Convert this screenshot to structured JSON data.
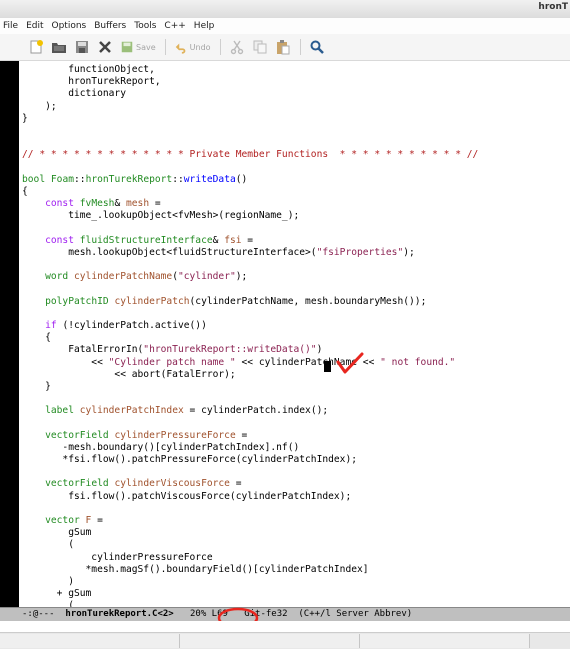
{
  "window": {
    "title": "hronT"
  },
  "menubar": {
    "items": [
      "File",
      "Edit",
      "Options",
      "Buffers",
      "Tools",
      "C++",
      "Help"
    ]
  },
  "toolbar": {
    "save_label": "Save",
    "undo_label": "Undo",
    "icons": [
      "new-file-icon",
      "open-folder-icon",
      "save-disk-icon",
      "close-x-icon",
      "save-icon",
      "undo-icon",
      "cut-icon",
      "copy-icon",
      "paste-icon",
      "search-icon"
    ]
  },
  "editor": {
    "lines": [
      [
        {
          "t": "        functionObject,"
        }
      ],
      [
        {
          "t": "        hronTurekReport,"
        }
      ],
      [
        {
          "t": "        dictionary"
        }
      ],
      [
        {
          "t": "    );"
        }
      ],
      [
        {
          "t": "}"
        }
      ],
      [
        {
          "t": ""
        }
      ],
      [
        {
          "t": ""
        }
      ],
      [
        {
          "t": "// * * * * * * * * * * * * * Private Member Functions  * * * * * * * * * * * //",
          "c": "cm"
        }
      ],
      [
        {
          "t": ""
        }
      ],
      [
        {
          "t": "bool",
          "c": "ty"
        },
        {
          "t": " "
        },
        {
          "t": "Foam",
          "c": "ty"
        },
        {
          "t": "::"
        },
        {
          "t": "hronTurekReport",
          "c": "ty"
        },
        {
          "t": "::"
        },
        {
          "t": "writeData",
          "c": "fn"
        },
        {
          "t": "()"
        }
      ],
      [
        {
          "t": "{"
        }
      ],
      [
        {
          "t": "    "
        },
        {
          "t": "const",
          "c": "kw"
        },
        {
          "t": " "
        },
        {
          "t": "fvMesh",
          "c": "ty"
        },
        {
          "t": "& "
        },
        {
          "t": "mesh",
          "c": "vr"
        },
        {
          "t": " ="
        }
      ],
      [
        {
          "t": "        time_.lookupObject<fvMesh>(regionName_);"
        }
      ],
      [
        {
          "t": ""
        }
      ],
      [
        {
          "t": "    "
        },
        {
          "t": "const",
          "c": "kw"
        },
        {
          "t": " "
        },
        {
          "t": "fluidStructureInterface",
          "c": "ty"
        },
        {
          "t": "& "
        },
        {
          "t": "fsi",
          "c": "vr"
        },
        {
          "t": " ="
        }
      ],
      [
        {
          "t": "        mesh.lookupObject<fluidStructureInterface>("
        },
        {
          "t": "\"fsiProperties\"",
          "c": "st"
        },
        {
          "t": ");"
        }
      ],
      [
        {
          "t": ""
        }
      ],
      [
        {
          "t": "    "
        },
        {
          "t": "word",
          "c": "ty"
        },
        {
          "t": " "
        },
        {
          "t": "cylinderPatchName",
          "c": "vr"
        },
        {
          "t": "("
        },
        {
          "t": "\"cylinder\"",
          "c": "st"
        },
        {
          "t": ");"
        }
      ],
      [
        {
          "t": ""
        }
      ],
      [
        {
          "t": "    "
        },
        {
          "t": "polyPatchID",
          "c": "ty"
        },
        {
          "t": " "
        },
        {
          "t": "cylinderPatch",
          "c": "vr"
        },
        {
          "t": "(cylinderPatchName, mesh.boundaryMesh());"
        }
      ],
      [
        {
          "t": ""
        }
      ],
      [
        {
          "t": "    "
        },
        {
          "t": "if",
          "c": "kw"
        },
        {
          "t": " (!cylinderPatch.active())"
        }
      ],
      [
        {
          "t": "    {"
        }
      ],
      [
        {
          "t": "        FatalErrorIn("
        },
        {
          "t": "\"hronTurekReport::writeData()\"",
          "c": "st"
        },
        {
          "t": ")"
        }
      ],
      [
        {
          "t": "            << "
        },
        {
          "t": "\"Cylinder patch name \"",
          "c": "st"
        },
        {
          "t": " << cylinderPatchName << "
        },
        {
          "t": "\" not found.\"",
          "c": "st"
        }
      ],
      [
        {
          "t": "                << abort(FatalError);"
        }
      ],
      [
        {
          "t": "    }"
        }
      ],
      [
        {
          "t": ""
        }
      ],
      [
        {
          "t": "    "
        },
        {
          "t": "label",
          "c": "ty"
        },
        {
          "t": " "
        },
        {
          "t": "cylinderPatchIndex",
          "c": "vr"
        },
        {
          "t": " = cylinderPatch.index();"
        }
      ],
      [
        {
          "t": ""
        }
      ],
      [
        {
          "t": "    "
        },
        {
          "t": "vectorField",
          "c": "ty"
        },
        {
          "t": " "
        },
        {
          "t": "cylinderPressureForce",
          "c": "vr"
        },
        {
          "t": " ="
        }
      ],
      [
        {
          "t": "       -mesh.boundary()[cylinderPatchIndex].nf()"
        }
      ],
      [
        {
          "t": "       *fsi.flow().patchPressureForce(cylinderPatchIndex);"
        }
      ],
      [
        {
          "t": ""
        }
      ],
      [
        {
          "t": "    "
        },
        {
          "t": "vectorField",
          "c": "ty"
        },
        {
          "t": " "
        },
        {
          "t": "cylinderViscousForce",
          "c": "vr"
        },
        {
          "t": " ="
        }
      ],
      [
        {
          "t": "        fsi.flow().patchViscousForce(cylinderPatchIndex);"
        }
      ],
      [
        {
          "t": ""
        }
      ],
      [
        {
          "t": "    "
        },
        {
          "t": "vector",
          "c": "ty"
        },
        {
          "t": " "
        },
        {
          "t": "F",
          "c": "vr"
        },
        {
          "t": " ="
        }
      ],
      [
        {
          "t": "        gSum"
        }
      ],
      [
        {
          "t": "        ("
        }
      ],
      [
        {
          "t": "            cylinderPressureForce"
        }
      ],
      [
        {
          "t": "           *mesh.magSf().boundaryField()[cylinderPatchIndex]"
        }
      ],
      [
        {
          "t": "        )"
        }
      ],
      [
        {
          "t": "      + gSum"
        }
      ],
      [
        {
          "t": "        ("
        }
      ]
    ]
  },
  "modeline": {
    "status": "-:@---  ",
    "buffer_name": "hronTurekReport.C<2>",
    "position_prefix": "   20% ",
    "line_number": "L69",
    "rest": "   Git-fe32  (C++/l Server Abbrev)"
  },
  "colors": {
    "keyword": "#a020f0",
    "type": "#228b22",
    "function": "#0000ff",
    "variable": "#a0522d",
    "string": "#8b2252",
    "comment": "#b22222",
    "annotation": "#e8261f",
    "modeline_bg": "#bfbfbf"
  }
}
